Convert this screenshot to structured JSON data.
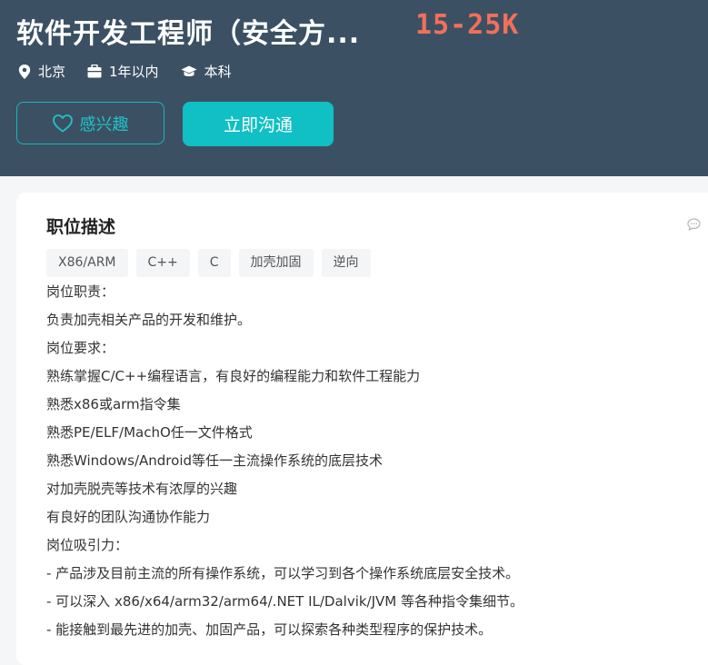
{
  "job": {
    "title": "软件开发工程师（安全方...",
    "salary": "15-25K",
    "location": "北京",
    "experience": "1年以内",
    "education": "本科"
  },
  "actions": {
    "favorite_label": "感兴趣",
    "chat_label": "立即沟通"
  },
  "description": {
    "heading": "职位描述",
    "tags": [
      "X86/ARM",
      "C++",
      "C",
      "加壳加固",
      "逆向"
    ],
    "lines": [
      "岗位职责：",
      "负责加壳相关产品的开发和维护。",
      "岗位要求：",
      "熟练掌握C/C++编程语言，有良好的编程能力和软件工程能力",
      "熟悉x86或arm指令集",
      "熟悉PE/ELF/MachO任一文件格式",
      "熟悉Windows/Android等任一主流操作系统的底层技术",
      "对加壳脱壳等技术有浓厚的兴趣",
      "有良好的团队沟通协作能力",
      "岗位吸引力：",
      "- 产品涉及目前主流的所有操作系统，可以学习到各个操作系统底层安全技术。",
      "- 可以深入 x86/x64/arm32/arm64/.NET IL/Dalvik/JVM 等各种指令集细节。",
      "- 能接触到最先进的加壳、加固产品，可以探索各种类型程序的保护技术。"
    ]
  },
  "colors": {
    "header_bg": "#3b5163",
    "accent": "#10c0c5",
    "salary": "#f2705a"
  },
  "icons": [
    "location-pin-icon",
    "briefcase-icon",
    "graduation-cap-icon",
    "heart-icon",
    "comment-icon"
  ]
}
